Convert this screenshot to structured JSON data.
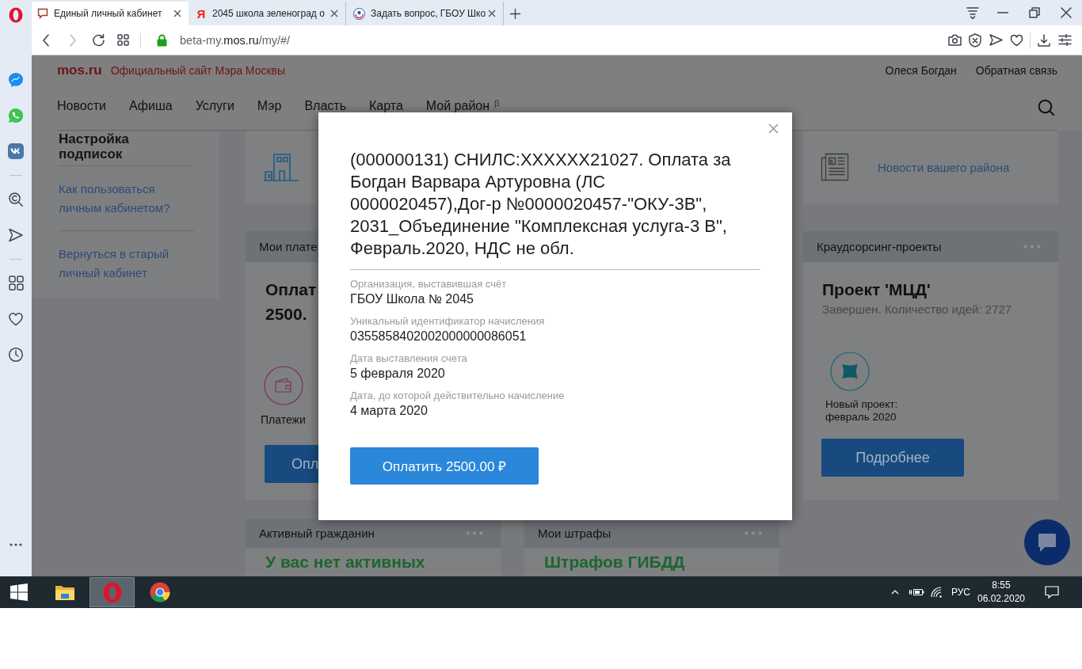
{
  "browser": {
    "tabs": [
      {
        "title": "Единый личный кабинет",
        "kind": "bubble",
        "selected": true
      },
      {
        "title": "2045 школа зеленоград о",
        "kind": "letter",
        "icon": "Я",
        "selected": false
      },
      {
        "title": "Задать вопрос, ГБОУ Шко",
        "kind": "emblem",
        "selected": false
      }
    ],
    "address": {
      "subdomain": "beta-my.",
      "domain": "mos.ru",
      "path": "/my/#/"
    }
  },
  "site": {
    "logo": "mos.ru",
    "tagline": "Официальный сайт Мэра Москвы",
    "user": "Олеся Богдан",
    "feedback": "Обратная связь",
    "nav": [
      {
        "label": "Новости"
      },
      {
        "label": "Афиша"
      },
      {
        "label": "Услуги"
      },
      {
        "label": "Мэр"
      },
      {
        "label": "Власть"
      },
      {
        "label": "Карта"
      },
      {
        "label": "Мой район",
        "badge": "β"
      }
    ]
  },
  "side_panel": {
    "heading": "Настройка подписок",
    "links": [
      "Как пользоваться личным кабинетом?",
      "Вернуться в старый личный кабинет"
    ]
  },
  "district_news": {
    "link": "Новости вашего района"
  },
  "payments": {
    "title": "Мои плате",
    "heading": "Оплат 2500.",
    "caption": "Платежи",
    "button": "Опл"
  },
  "crowdsourcing": {
    "title": "Краудсорсинг-проекты",
    "project": "Проект 'МЦД'",
    "status": "Завершен. Количество идей: 2727",
    "caption": "Новый проект: февраль 2020",
    "button": "Подробнее"
  },
  "bottom_cards": [
    {
      "title": "Активный гражданин",
      "text": "У вас нет активных"
    },
    {
      "title": "Мои штрафы",
      "text": "Штрафов ГИБДД"
    }
  ],
  "modal": {
    "title": "(000000131) СНИЛС:XXXXXX21027. Оплата за Богдан Варвара Артуровна (ЛС 0000020457),Дог-р №0000020457-\"ОКУ-3В\", 2031_Объединение \"Комплексная услуга-3 В\", Февраль.2020, НДС не обл.",
    "fields": [
      {
        "label": "Организация, выставившая счёт",
        "value": "ГБОУ Школа № 2045"
      },
      {
        "label": "Уникальный идентификатор начисления",
        "value": "0355858402002000000086051"
      },
      {
        "label": "Дата выставления счета",
        "value": "5 февраля 2020"
      },
      {
        "label": "Дата, до которой действительно начисление",
        "value": "4 марта 2020"
      }
    ],
    "button": "Оплатить 2500.00 ₽"
  },
  "taskbar": {
    "apps": [
      {
        "kind": "explorer",
        "selected": false
      },
      {
        "kind": "opera",
        "selected": true
      },
      {
        "kind": "chrome",
        "selected": false
      }
    ],
    "language": "РУС",
    "time": "8:55",
    "date": "06.02.2020"
  }
}
